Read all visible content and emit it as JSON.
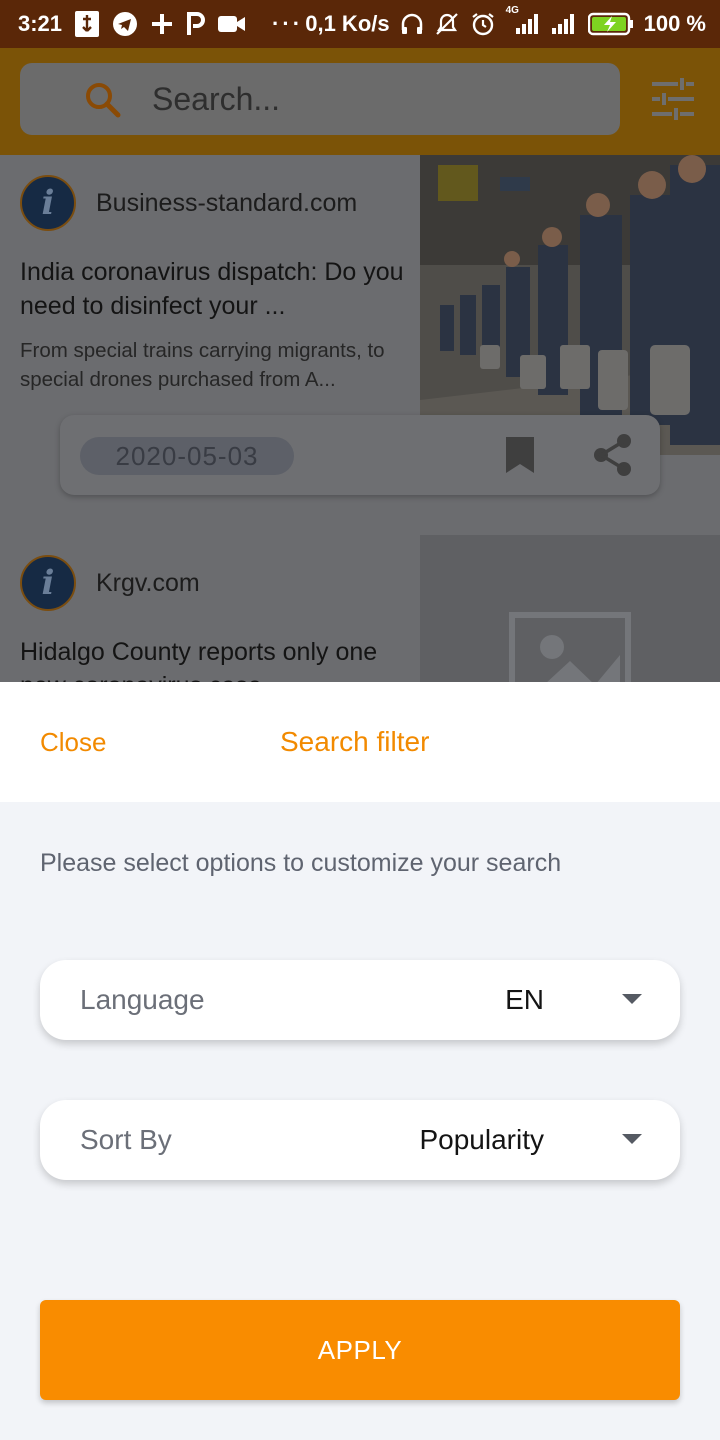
{
  "status_bar": {
    "time": "3:21",
    "net_speed": "0,1 Ko/s",
    "network_type": "4G",
    "battery": "100 %",
    "background_color": "#5a2708"
  },
  "header": {
    "search_placeholder": "Search...",
    "accent_color": "#f28a00",
    "icons": [
      "search-icon",
      "filter-icon"
    ]
  },
  "feed": {
    "articles": [
      {
        "source": "Business-standard.com",
        "headline": "India coronavirus dispatch: Do you need to disinfect your ...",
        "snippet": "From special trains carrying migrants, to special drones purchased from A...",
        "date": "2020-05-03",
        "image": "photo-migrants-train-platform"
      },
      {
        "source": "Krgv.com",
        "headline": "Hidalgo County reports only one new coronavirus case",
        "image": "image-placeholder"
      }
    ]
  },
  "filter_sheet": {
    "close_label": "Close",
    "title": "Search filter",
    "description": "Please select options to customize your search",
    "language": {
      "label": "Language",
      "value": "EN"
    },
    "sort_by": {
      "label": "Sort By",
      "value": "Popularity"
    },
    "apply_label": "APPLY",
    "apply_color": "#f98c00"
  }
}
